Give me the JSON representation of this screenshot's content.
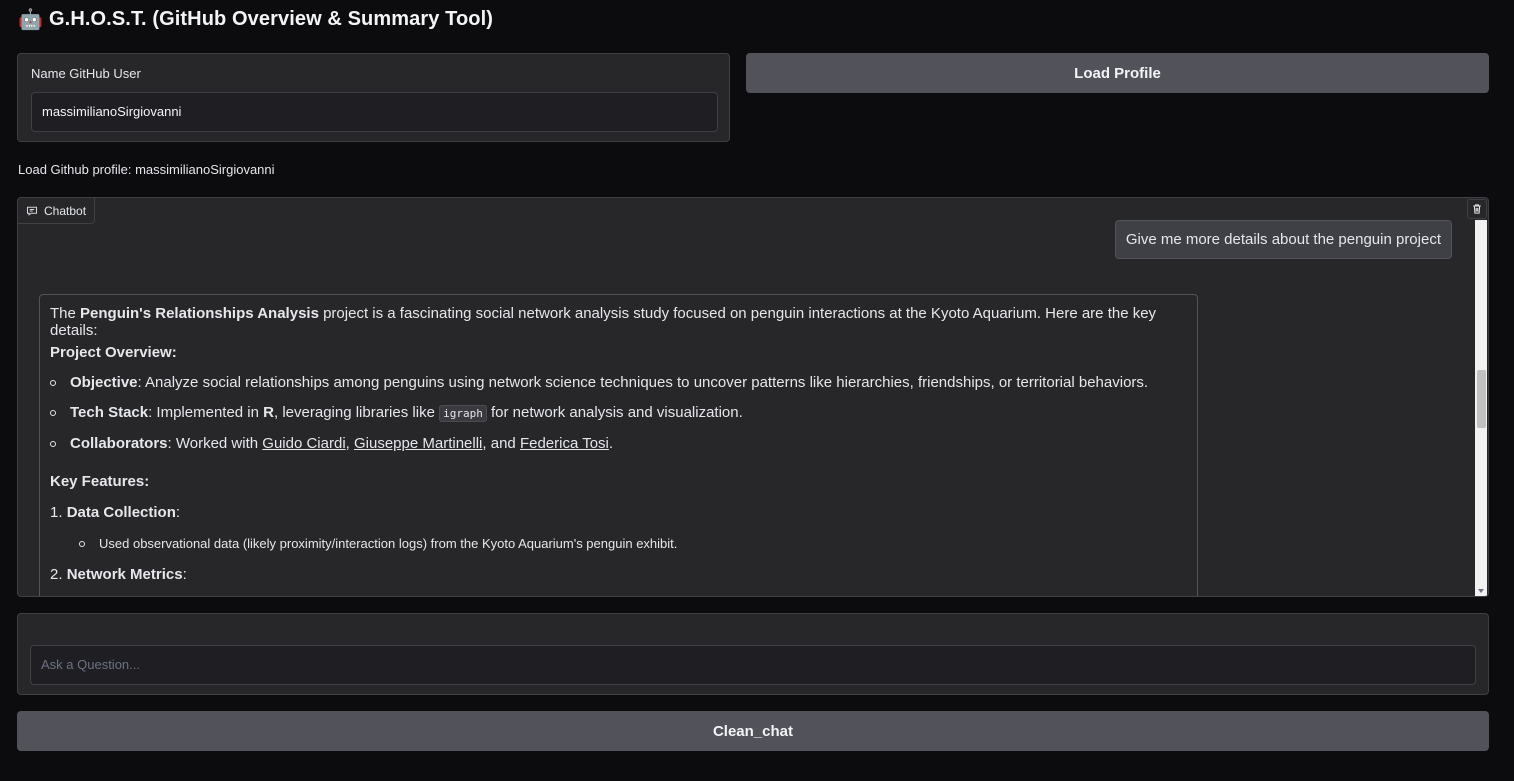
{
  "app": {
    "title": "G.H.O.S.T. (GitHub Overview & Summary Tool)",
    "emoji": "🤖"
  },
  "user_panel": {
    "label": "Name GitHub User",
    "value": "massimilianoSirgiovanni"
  },
  "load_button": "Load Profile",
  "status": "Load Github profile: massimilianoSirgiovanni",
  "chat": {
    "tag": "Chatbot",
    "user_message": "Give me more details about the penguin project",
    "bot": {
      "intro_pre": "The ",
      "intro_bold": "Penguin's Relationships Analysis",
      "intro_post": " project is a fascinating social network analysis study focused on penguin interactions at the Kyoto Aquarium. Here are the key details:",
      "overview_heading": "Project Overview:",
      "objective_label": "Objective",
      "objective_text": ": Analyze social relationships among penguins using network science techniques to uncover patterns like hierarchies, friendships, or territorial behaviors.",
      "tech_label": "Tech Stack",
      "tech_text1": ": Implemented in ",
      "tech_r": "R",
      "tech_text2": ", leveraging libraries like ",
      "tech_code": "igraph",
      "tech_text3": " for network analysis and visualization.",
      "collab_label": "Collaborators",
      "collab_text1": ": Worked with ",
      "collab_1": "Guido Ciardi",
      "collab_sep1": ", ",
      "collab_2": "Giuseppe Martinelli",
      "collab_sep2": ", and ",
      "collab_3": "Federica Tosi",
      "collab_end": ".",
      "features_heading": "Key Features:",
      "f1_num": "1. ",
      "f1_label": "Data Collection",
      "f1_colon": ":",
      "f1_sub": "Used observational data (likely proximity/interaction logs) from the Kyoto Aquarium's penguin exhibit.",
      "f2_num": "2. ",
      "f2_label": "Network Metrics",
      "f2_colon": ":"
    }
  },
  "ask": {
    "placeholder": "Ask a Question..."
  },
  "clean_button": "Clean_chat"
}
